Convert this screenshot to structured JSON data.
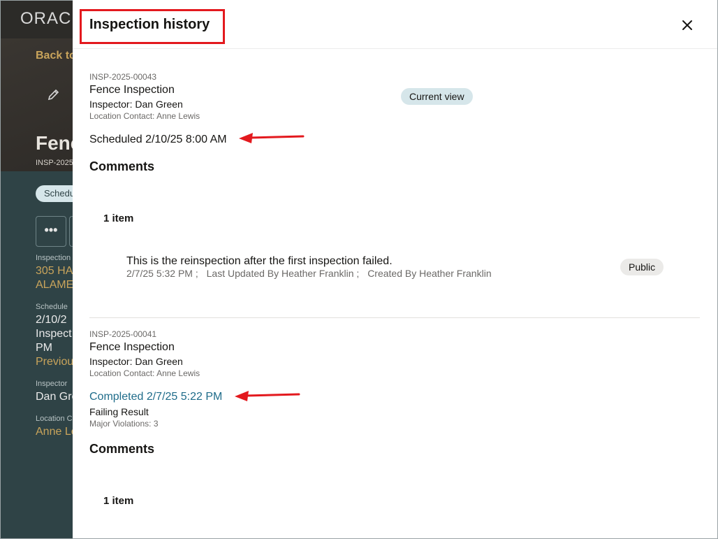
{
  "background": {
    "logo": "ORAC",
    "back_link": "Back to",
    "title": "Fenc",
    "subtitle": "INSP-2025",
    "status": "Schedu",
    "more_label": "•••",
    "fields": [
      {
        "label": "Inspection",
        "values": [
          "305 HA",
          "ALAME"
        ],
        "is_link": true
      },
      {
        "label": "Schedule",
        "values": [
          "2/10/2",
          "Inspect",
          "PM"
        ],
        "link": "Previou"
      },
      {
        "label": "Inspector",
        "values": [
          "Dan Gre"
        ]
      },
      {
        "label": "Location C",
        "values": [
          "Anne Le"
        ],
        "is_link": true
      }
    ]
  },
  "drawer": {
    "title": "Inspection history",
    "close_icon": "close-icon"
  },
  "records": [
    {
      "id": "INSP-2025-00043",
      "name": "Fence Inspection",
      "inspector": "Inspector: Dan Green",
      "contact": "Location Contact: Anne Lewis",
      "badge": "Current view",
      "date": "Scheduled 2/10/25 8:00 AM",
      "comments_title": "Comments",
      "item_count": "1 item",
      "comments": [
        {
          "text": "This is the reinspection after the first inspection failed.",
          "date": "2/7/25 5:32 PM ;",
          "updated": "Last Updated By Heather Franklin ;",
          "created": "Created By Heather Franklin",
          "badge": "Public"
        }
      ]
    },
    {
      "id": "INSP-2025-00041",
      "name": "Fence Inspection",
      "inspector": "Inspector: Dan Green",
      "contact": "Location Contact: Anne Lewis",
      "date": "Completed 2/7/25 5:22 PM",
      "result": "Failing Result",
      "violations": "Major Violations: 3",
      "comments_title": "Comments",
      "item_count": "1 item"
    }
  ],
  "colors": {
    "highlight_box": "#e3191e",
    "arrow": "#e3191e",
    "link": "#1f6c8a",
    "background_dark": "#2f4346",
    "accent_gold": "#c9a45b"
  }
}
